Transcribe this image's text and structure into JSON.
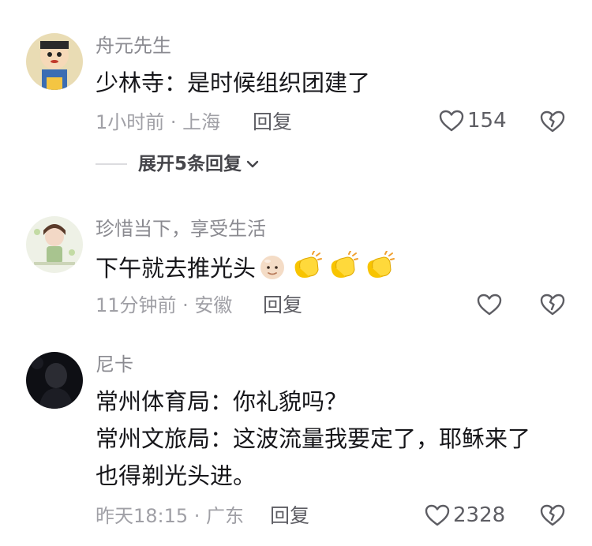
{
  "comments": [
    {
      "username": "舟元先生",
      "lines": [
        "少林寺：是时候组织团建了"
      ],
      "time_location": "1小时前 · 上海",
      "reply_label": "回复",
      "likes": "154",
      "expand_label": "展开5条回复"
    },
    {
      "username": "珍惜当下，享受生活",
      "lines": [
        "下午就去推光头"
      ],
      "emojis": [
        "bald-face",
        "clapping-hands",
        "clapping-hands",
        "clapping-hands"
      ],
      "time_location": "11分钟前 · 安徽",
      "reply_label": "回复",
      "likes": ""
    },
    {
      "username": "尼卡",
      "lines": [
        "常州体育局：你礼貌吗？",
        "常州文旅局：这波流量我要定了，耶稣来了",
        "也得剃光头进。"
      ],
      "time_location": "昨天18:15 · 广东",
      "reply_label": "回复",
      "likes": "2328"
    }
  ],
  "colors": {
    "username": "#8a8a90",
    "text": "#16161a",
    "meta": "#a0a0a6",
    "action": "#5d5d63"
  }
}
